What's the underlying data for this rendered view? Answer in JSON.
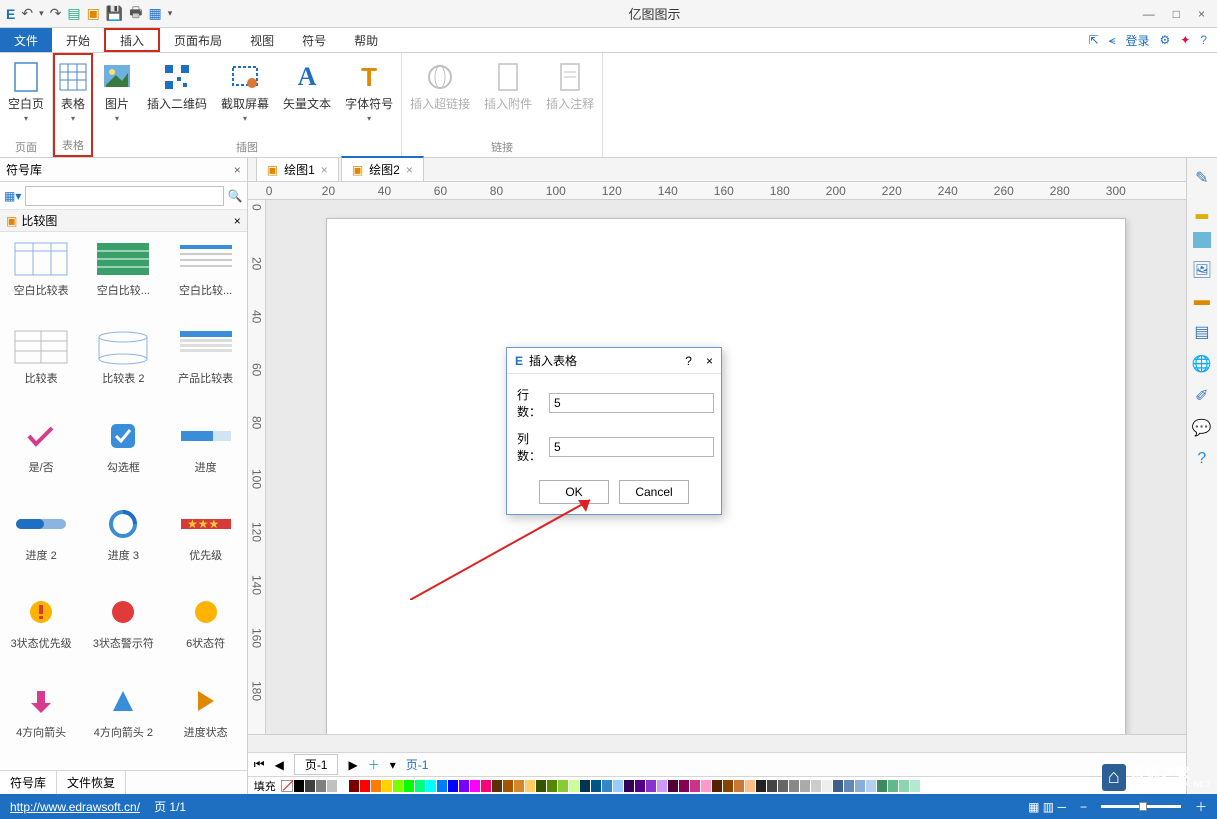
{
  "app_title": "亿图图示",
  "qat_icons": [
    "logo",
    "undo-arrow",
    "redo-arrow",
    "new-doc",
    "open-doc",
    "save",
    "print",
    "options",
    "drop"
  ],
  "win_controls": [
    "—",
    "□",
    "×"
  ],
  "menu": {
    "file": "文件",
    "tabs": [
      "开始",
      "插入",
      "页面布局",
      "视图",
      "符号",
      "帮助"
    ],
    "active": "插入",
    "right_login": "登录"
  },
  "ribbon": {
    "groups": [
      {
        "label": "页面",
        "items": [
          {
            "name": "blank-page",
            "label": "空白页",
            "drop": true
          }
        ]
      },
      {
        "label": "表格",
        "highlight": true,
        "items": [
          {
            "name": "table",
            "label": "表格",
            "drop": true
          }
        ]
      },
      {
        "label": "插图",
        "items": [
          {
            "name": "picture",
            "label": "图片",
            "drop": true
          },
          {
            "name": "qrcode",
            "label": "插入二维码"
          },
          {
            "name": "screenshot",
            "label": "截取屏幕",
            "drop": true
          },
          {
            "name": "vector-text",
            "label": "矢量文本"
          },
          {
            "name": "font-symbol",
            "label": "字体符号",
            "drop": true
          }
        ]
      },
      {
        "label": "链接",
        "items": [
          {
            "name": "hyperlink",
            "label": "插入超链接",
            "disabled": true
          },
          {
            "name": "attachment",
            "label": "插入附件",
            "disabled": true
          },
          {
            "name": "comment",
            "label": "插入注释",
            "disabled": true
          }
        ]
      }
    ]
  },
  "symbol_panel": {
    "title": "符号库",
    "search_placeholder": "",
    "category": "比较图",
    "shapes": [
      "空白比较表",
      "空白比较...",
      "空白比较...",
      "比较表",
      "比较表 2",
      "产品比较表",
      "是/否",
      "勾选框",
      "进度",
      "进度 2",
      "进度 3",
      "优先级",
      "3状态优先级",
      "3状态警示符",
      "6状态符",
      "4方向箭头",
      "4方向箭头 2",
      "进度状态"
    ],
    "bottom_tabs": [
      "符号库",
      "文件恢复"
    ]
  },
  "doc_tabs": [
    {
      "name": "绘图1",
      "active": false
    },
    {
      "name": "绘图2",
      "active": true
    }
  ],
  "ruler_ticks": [
    "0",
    "20",
    "40",
    "60",
    "80",
    "100",
    "120",
    "140",
    "160",
    "180",
    "200",
    "220",
    "240",
    "260",
    "280",
    "300"
  ],
  "ruler_v_ticks": [
    "0",
    "20",
    "40",
    "60",
    "80",
    "100",
    "120",
    "140",
    "160",
    "180"
  ],
  "dialog": {
    "title": "插入表格",
    "rows_label": "行数：",
    "rows_value": "5",
    "cols_label": "列数：",
    "cols_value": "5",
    "ok": "OK",
    "cancel": "Cancel"
  },
  "bottom_page_tabs": {
    "left": "页-1",
    "right": "页-1"
  },
  "palette_label": "填充",
  "palette_colors": [
    "#000000",
    "#404040",
    "#808080",
    "#c0c0c0",
    "#ffffff",
    "#7b0000",
    "#ff0000",
    "#ff7b00",
    "#ffd200",
    "#7bff00",
    "#00ff00",
    "#00ff7b",
    "#00ffff",
    "#007bff",
    "#0000ff",
    "#7b00ff",
    "#ff00ff",
    "#ff007b",
    "#5c2f00",
    "#a55500",
    "#d48827",
    "#ffcc66",
    "#335500",
    "#558800",
    "#88cc33",
    "#ccff99",
    "#003355",
    "#005588",
    "#3388cc",
    "#99ccff",
    "#330055",
    "#550088",
    "#8833cc",
    "#cc99ff",
    "#550033",
    "#880055",
    "#cc3388",
    "#ff99cc",
    "#552200",
    "#884400",
    "#cc7733",
    "#ffbb88",
    "#222222",
    "#444444",
    "#666666",
    "#888888",
    "#aaaaaa",
    "#cccccc",
    "#eeeeee",
    "#3e5f8a",
    "#6188b8",
    "#8aaed6",
    "#b3cfea",
    "#3e8a5f",
    "#61b888",
    "#8ad6ae",
    "#b3eacf"
  ],
  "status": {
    "url": "http://www.edrawsoft.cn/",
    "page": "页 1/1"
  },
  "watermark": {
    "brand": "系统之家",
    "domain": "XITONGZHIJIA.NET"
  }
}
